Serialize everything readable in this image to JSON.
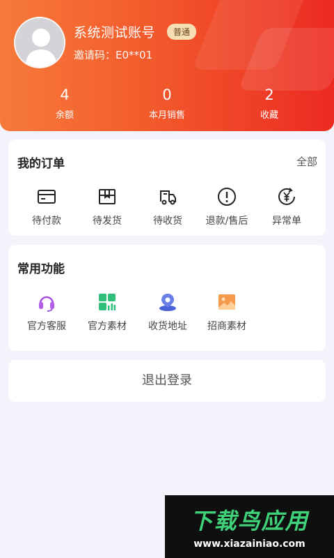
{
  "profile": {
    "name": "系统测试账号",
    "badge": "普通",
    "invite_code": "邀请码：E0**01"
  },
  "stats": [
    {
      "value": "4",
      "label": "余额"
    },
    {
      "value": "0",
      "label": "本月销售"
    },
    {
      "value": "2",
      "label": "收藏"
    }
  ],
  "orders": {
    "title": "我的订单",
    "all_label": "全部",
    "items": [
      {
        "label": "待付款",
        "icon": "card-icon"
      },
      {
        "label": "待发货",
        "icon": "box-icon"
      },
      {
        "label": "待收货",
        "icon": "truck-icon"
      },
      {
        "label": "退款/售后",
        "icon": "alert-circle-icon"
      },
      {
        "label": "异常单",
        "icon": "yen-refresh-icon"
      }
    ]
  },
  "functions": {
    "title": "常用功能",
    "items": [
      {
        "label": "官方客服",
        "icon": "headset-icon"
      },
      {
        "label": "官方素材",
        "icon": "grid-chart-icon"
      },
      {
        "label": "收货地址",
        "icon": "location-pin-icon"
      },
      {
        "label": "招商素材",
        "icon": "image-icon"
      }
    ]
  },
  "logout_label": "退出登录",
  "watermark": {
    "title": "下载鸟应用",
    "url": "www.xiazainiao.com"
  },
  "colors": {
    "header_start": "#f77a3a",
    "header_end": "#ec2a22",
    "badge_bg": "#f6dfb5",
    "page_bg": "#f3f3fb"
  }
}
